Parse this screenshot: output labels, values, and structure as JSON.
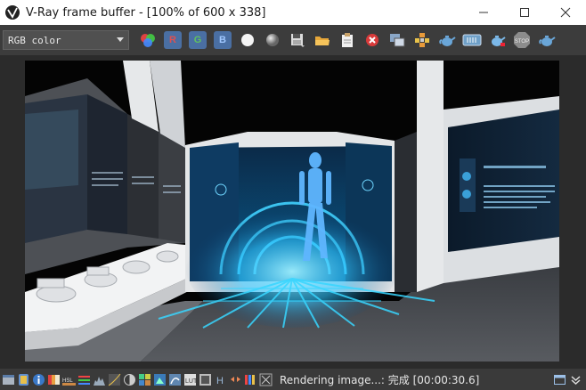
{
  "window": {
    "title": "V-Ray frame buffer - [100% of 600 x 338]"
  },
  "toolbar": {
    "channel_value": "RGB color",
    "r_label": "R",
    "g_label": "G",
    "b_label": "B",
    "icons": [
      "color-circles-icon",
      "red-channel-icon",
      "green-channel-icon",
      "blue-channel-icon",
      "white-circle-icon",
      "gray-circle-icon",
      "save-icon",
      "open-folder-icon",
      "clipboard-icon",
      "clear-icon",
      "track-mouse-icon",
      "region-render-icon",
      "teapot-icon",
      "history-icon",
      "render-teapot-icon",
      "stop-icon",
      "teapot-render-icon"
    ]
  },
  "status": {
    "text": "Rendering image...: 完成 [00:00:30.6]"
  },
  "colors": {
    "titlebar": "#ffffff",
    "toolbar": "#3c3c3c",
    "background": "#2b2b2b",
    "statusbar": "#3a3a3a",
    "hologram": "#2fc4ff"
  }
}
